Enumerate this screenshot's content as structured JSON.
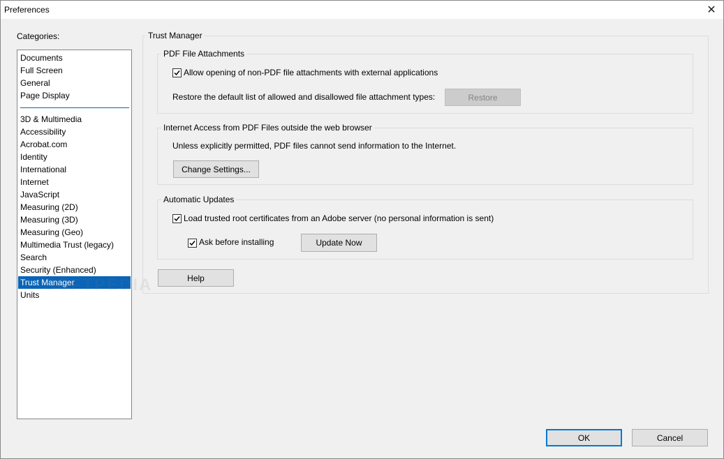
{
  "window": {
    "title": "Preferences",
    "close_glyph": "✕"
  },
  "categories": {
    "label": "Categories:",
    "top_items": [
      "Documents",
      "Full Screen",
      "General",
      "Page Display"
    ],
    "items": [
      "3D & Multimedia",
      "Accessibility",
      "Acrobat.com",
      "Identity",
      "International",
      "Internet",
      "JavaScript",
      "Measuring (2D)",
      "Measuring (3D)",
      "Measuring (Geo)",
      "Multimedia Trust (legacy)",
      "Search",
      "Security (Enhanced)",
      "Trust Manager",
      "Units"
    ],
    "selected": "Trust Manager"
  },
  "watermark": "SOFTPEDIA",
  "trust_manager": {
    "title": "Trust Manager",
    "pdf_attachments": {
      "title": "PDF File Attachments",
      "allow_label": "Allow opening of non-PDF file attachments with external applications",
      "allow_checked": true,
      "restore_text": "Restore the default list of allowed and disallowed file attachment types:",
      "restore_button": "Restore"
    },
    "internet_access": {
      "title": "Internet Access from PDF Files outside the web browser",
      "description": "Unless explicitly permitted, PDF files cannot send information to the Internet.",
      "change_button": "Change Settings..."
    },
    "auto_updates": {
      "title": "Automatic Updates",
      "load_label": "Load trusted root certificates from an Adobe server (no personal information is sent)",
      "load_checked": true,
      "ask_label": "Ask before installing",
      "ask_checked": true,
      "update_button": "Update Now"
    },
    "help_button": "Help"
  },
  "footer": {
    "ok": "OK",
    "cancel": "Cancel"
  },
  "colors": {
    "selection": "#0a64b8",
    "background": "#f0f0f0",
    "default_button_border": "#0078d7"
  }
}
